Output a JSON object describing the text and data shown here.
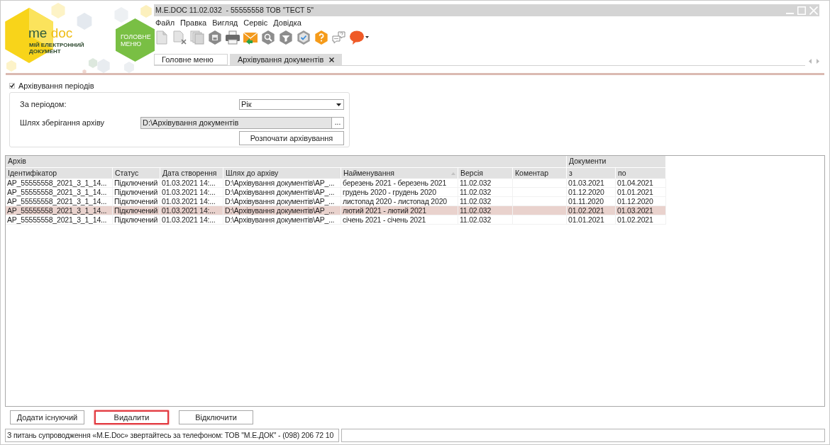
{
  "logo": {
    "wordmark_left": "me",
    "wordmark_right": "doc",
    "tagline": "МІЙ ЕЛЕКТРОННИЙ ДОКУМЕНТ"
  },
  "main_menu_button": "ГОЛОВНЕ МЕНЮ",
  "window": {
    "title": "M.E.DOC 11.02.032  - 55555558 ТОВ \"ТЕСТ 5\""
  },
  "menu": [
    "Файл",
    "Правка",
    "Вигляд",
    "Сервіс",
    "Довідка"
  ],
  "tabs": [
    {
      "label": "Головне меню",
      "selected": false,
      "closable": false
    },
    {
      "label": "Архівування документів",
      "selected": true,
      "closable": true
    }
  ],
  "archive_periods": {
    "label": "Архівування періодів",
    "checked": true
  },
  "period": {
    "label": "За періодом:",
    "value": "Рік"
  },
  "archive_path": {
    "label": "Шлях зберігання архіву",
    "value": "D:\\Архівування документів",
    "browse": "..."
  },
  "start_button": "Розпочати архівування",
  "table": {
    "groups": [
      {
        "label": "Архів",
        "columns": [
          {
            "label": "Ідентифікатор",
            "sorted": false
          },
          {
            "label": "Статус",
            "sorted": false
          },
          {
            "label": "Дата створення",
            "sorted": false
          },
          {
            "label": "Шлях до архіву",
            "sorted": false
          },
          {
            "label": "Найменування",
            "sorted": true
          },
          {
            "label": "Версія",
            "sorted": false
          },
          {
            "label": "Коментар",
            "sorted": false
          }
        ]
      },
      {
        "label": "Документи",
        "columns": [
          {
            "label": "з",
            "sorted": false
          },
          {
            "label": "по",
            "sorted": false
          }
        ]
      }
    ],
    "rows": [
      {
        "selected": false,
        "cells": [
          "AP_55555558_2021_3_1_14...",
          "Підключений",
          "01.03.2021 14:...",
          "D:\\Архівування документів\\AP_...",
          "березень 2021 - березень 2021",
          "11.02.032",
          null,
          "01.03.2021",
          "01.04.2021"
        ]
      },
      {
        "selected": false,
        "cells": [
          "AP_55555558_2021_3_1_14...",
          "Підключений",
          "01.03.2021 14:...",
          "D:\\Архівування документів\\AP_...",
          "грудень 2020 - грудень 2020",
          "11.02.032",
          null,
          "01.12.2020",
          "01.01.2021"
        ]
      },
      {
        "selected": false,
        "cells": [
          "AP_55555558_2021_3_1_14...",
          "Підключений",
          "01.03.2021 14:...",
          "D:\\Архівування документів\\AP_...",
          "листопад 2020 - листопад 2020",
          "11.02.032",
          null,
          "01.11.2020",
          "01.12.2020"
        ]
      },
      {
        "selected": true,
        "cells": [
          "AP_55555558_2021_3_1_14...",
          "Підключений",
          "01.03.2021 14:...",
          "D:\\Архівування документів\\AP_...",
          "лютий 2021 - лютий 2021",
          "11.02.032",
          null,
          "01.02.2021",
          "01.03.2021"
        ]
      },
      {
        "selected": false,
        "cells": [
          "AP_55555558_2021_3_1_14...",
          "Підключений",
          "01.03.2021 14:...",
          "D:\\Архівування документів\\AP_...",
          "січень 2021 - січень 2021",
          "11.02.032",
          null,
          "01.01.2021",
          "01.02.2021"
        ]
      }
    ]
  },
  "buttons": [
    {
      "label": "Додати існуючий",
      "highlighted": false
    },
    {
      "label": "Видалити",
      "highlighted": true
    },
    {
      "label": "Відключити",
      "highlighted": false
    }
  ],
  "status_bar": {
    "message": "З питань супроводження «M.E.Doc» звертайтесь за телефоном: ТОВ \"М.Е.ДОК\" - (098) 206 72 10"
  }
}
